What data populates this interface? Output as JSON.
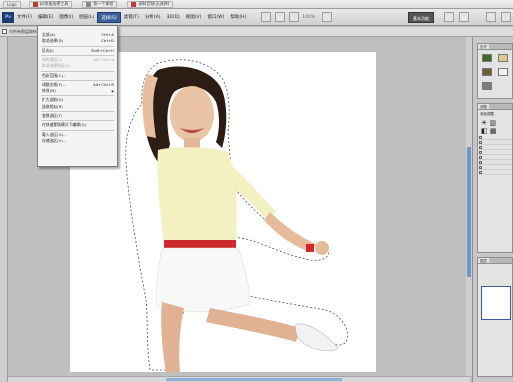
{
  "colors": {
    "menu_highlight": "#3c5f9a",
    "accent_red": "#cc2a2a",
    "scroll_thumb": "#6d96c9",
    "foreground_swatch": "#3c6b2a",
    "background_swatch": "#e0c98c"
  },
  "taskbar": {
    "items": [
      {
        "label": "Logo",
        "icon": "app-icon"
      },
      {
        "label": "ps快速选择工具",
        "icon": "window-icon"
      },
      {
        "label": "第一个课程",
        "icon": "window-icon"
      },
      {
        "label": "录制音频(无选择)",
        "icon": "window-icon"
      }
    ]
  },
  "menubar": {
    "items": [
      "Ps",
      "文件(F)",
      "编辑(E)",
      "图像(I)",
      "图层(L)",
      "选择(S)",
      "滤镜(T)",
      "分析(A)",
      "3D(D)",
      "视图(V)",
      "窗口(W)",
      "帮助(H)"
    ],
    "open_index": 2,
    "zoom": "100%",
    "workspace_button": "基本功能"
  },
  "options": {
    "checkbox_label": "对所有图层取样"
  },
  "dropdown": {
    "items": [
      {
        "label": "全部(A)",
        "shortcut": "Ctrl+A",
        "disabled": false
      },
      {
        "label": "取消选择(D)",
        "shortcut": "Ctrl+D",
        "disabled": false
      },
      {
        "label": "",
        "shortcut": "",
        "disabled": true,
        "separator": true
      },
      {
        "label": "反向(I)",
        "shortcut": "Shift+Ctrl+I",
        "disabled": false
      },
      {
        "label": "",
        "shortcut": "",
        "disabled": true,
        "separator": true
      },
      {
        "label": "所有图层(L)",
        "shortcut": "Alt+Ctrl+A",
        "disabled": true
      },
      {
        "label": "取消选择图层(S)",
        "shortcut": "",
        "disabled": true
      },
      {
        "label": "",
        "shortcut": "",
        "disabled": true,
        "separator": true
      },
      {
        "label": "色彩范围(C)...",
        "shortcut": "",
        "disabled": false
      },
      {
        "label": "",
        "shortcut": "",
        "disabled": true,
        "separator": true
      },
      {
        "label": "调整边缘(F)...",
        "shortcut": "Alt+Ctrl+R",
        "disabled": false
      },
      {
        "label": "修改(M)",
        "shortcut": "",
        "disabled": false,
        "submenu": true
      },
      {
        "label": "",
        "shortcut": "",
        "disabled": true,
        "separator": true
      },
      {
        "label": "扩大选取(G)",
        "shortcut": "",
        "disabled": false
      },
      {
        "label": "选取相似(R)",
        "shortcut": "",
        "disabled": false
      },
      {
        "label": "",
        "shortcut": "",
        "disabled": true,
        "separator": true
      },
      {
        "label": "变换选区(T)",
        "shortcut": "",
        "disabled": false
      },
      {
        "label": "",
        "shortcut": "",
        "disabled": true,
        "separator": true
      },
      {
        "label": "在快速蒙版模式下编辑(Q)",
        "shortcut": "",
        "disabled": false
      },
      {
        "label": "",
        "shortcut": "",
        "disabled": true,
        "separator": true
      },
      {
        "label": "载入选区(O)...",
        "shortcut": "",
        "disabled": false
      },
      {
        "label": "存储选区(V)...",
        "shortcut": "",
        "disabled": false
      }
    ]
  },
  "panels": {
    "history_tab": "历史",
    "adjust_tab": "调整",
    "layers_tab": "图层",
    "swatch_label": "添加调整",
    "history_rows": [
      "",
      "",
      "",
      "",
      "",
      "",
      "",
      ""
    ]
  }
}
